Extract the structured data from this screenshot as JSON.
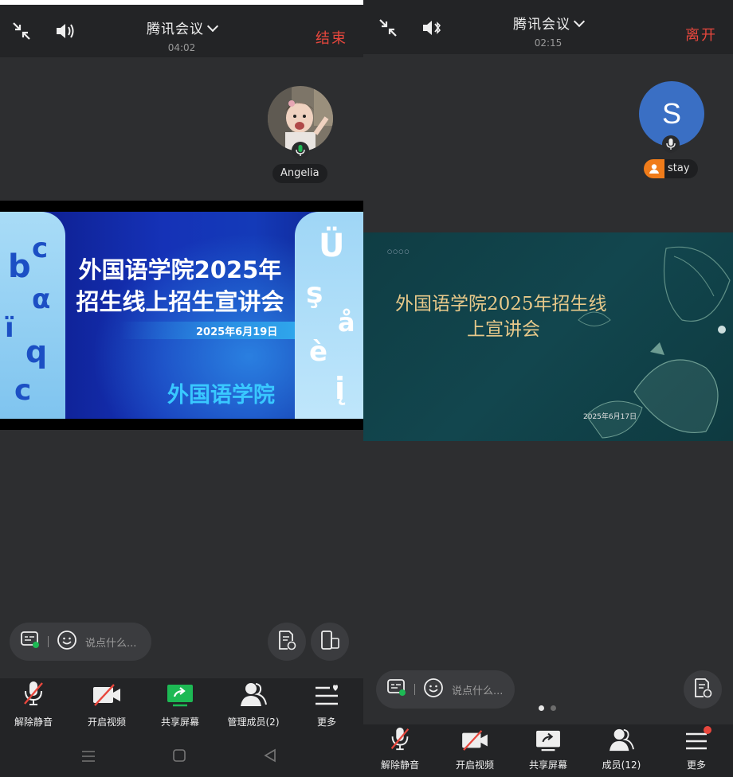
{
  "left": {
    "title": "腾讯会议",
    "timer": "04:02",
    "end_label": "结束",
    "participant_name": "Angelia",
    "slide": {
      "title_line1": "外国语学院2025年",
      "title_line2": "招生线上招生宣讲会",
      "date": "2025年6月19日",
      "org": "外国语学院",
      "left_letters": [
        "b",
        "c",
        "α",
        "ï",
        "q",
        "c"
      ],
      "right_letters": [
        "Ü",
        "ş",
        "å",
        "è",
        "į"
      ]
    },
    "chat_placeholder": "说点什么...",
    "toolbar": {
      "unmute": "解除静音",
      "video": "开启视频",
      "share": "共享屏幕",
      "members": "管理成员(2)",
      "more": "更多"
    }
  },
  "right": {
    "title": "腾讯会议",
    "timer": "02:15",
    "leave_label": "离开",
    "avatar_letter": "S",
    "participant_name": "stay",
    "slide": {
      "title_line1": "外国语学院2025年招生线",
      "title_line2": "上宣讲会",
      "date": "2025年6月17日",
      "corner_dots": "○○○○"
    },
    "chat_placeholder": "说点什么...",
    "toolbar": {
      "unmute": "解除静音",
      "video": "开启视频",
      "share": "共享屏幕",
      "members": "成员(12)",
      "more": "更多"
    }
  },
  "colors": {
    "end_red": "#e8473d",
    "share_green": "#1db954",
    "avatar_blue": "#3a6fc4",
    "badge_orange": "#f07c1a",
    "bg_dark": "#2d2e30",
    "bar_dark": "#232426"
  }
}
